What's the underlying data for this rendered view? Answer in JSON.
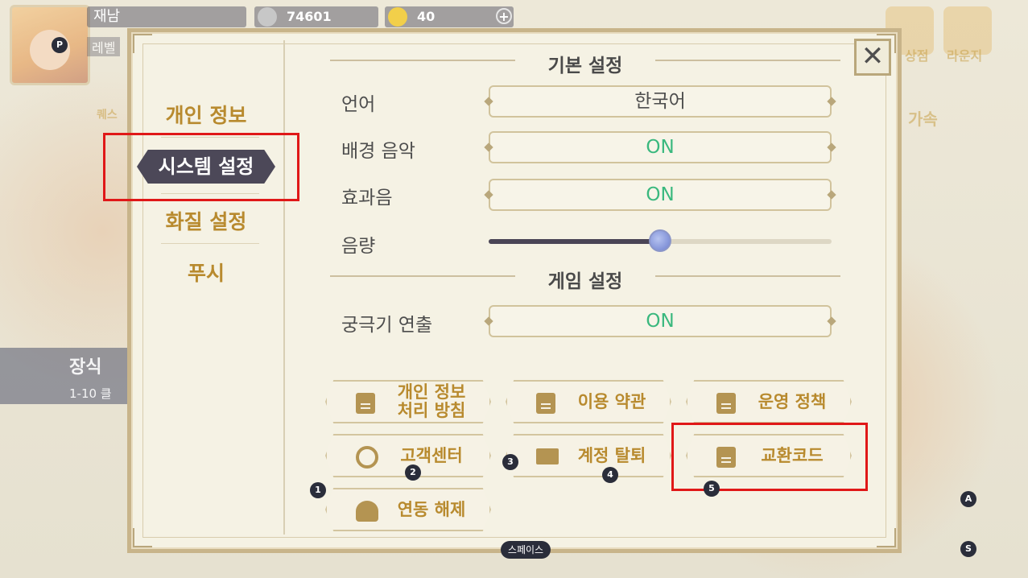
{
  "hud": {
    "player_name": "재남",
    "level_label": "레벨",
    "currency_silver": "74601",
    "currency_gold": "40",
    "right_labels": [
      "상점",
      "라운지"
    ],
    "side_labels": [
      "퀘스",
      "가속"
    ],
    "decoration_title": "장식",
    "decoration_subtitle": "1-10 클"
  },
  "modal": {
    "close_label": "✕",
    "nav": [
      {
        "label": "개인 정보"
      },
      {
        "label": "시스템 설정"
      },
      {
        "label": "화질 설정"
      },
      {
        "label": "푸시"
      }
    ],
    "basic_section_title": "기본 설정",
    "game_section_title": "게임 설정",
    "settings": {
      "language": {
        "label": "언어",
        "value": "한국어"
      },
      "bgm": {
        "label": "배경 음악",
        "value": "ON"
      },
      "sfx": {
        "label": "효과음",
        "value": "ON"
      },
      "volume": {
        "label": "음량",
        "level": 0.5
      },
      "ultimate": {
        "label": "궁극기 연출",
        "value": "ON"
      }
    },
    "links": {
      "privacy_line1": "개인 정보",
      "privacy_line2": "처리 방침",
      "terms": "이용 약관",
      "policy": "운영 정책",
      "support": "고객센터",
      "withdraw": "계정 탈퇴",
      "exchange_code": "교환코드",
      "unlink": "연동 해제"
    }
  },
  "shortcuts": {
    "p": "P",
    "one": "1",
    "two": "2",
    "three": "3",
    "four": "4",
    "five": "5",
    "a": "A",
    "s": "S",
    "space": "스페이스"
  },
  "colors": {
    "highlight": "#e01818",
    "on_value": "#3ab87e",
    "nav_text": "#b88a2e",
    "nav_active_bg": "#4c4858"
  }
}
